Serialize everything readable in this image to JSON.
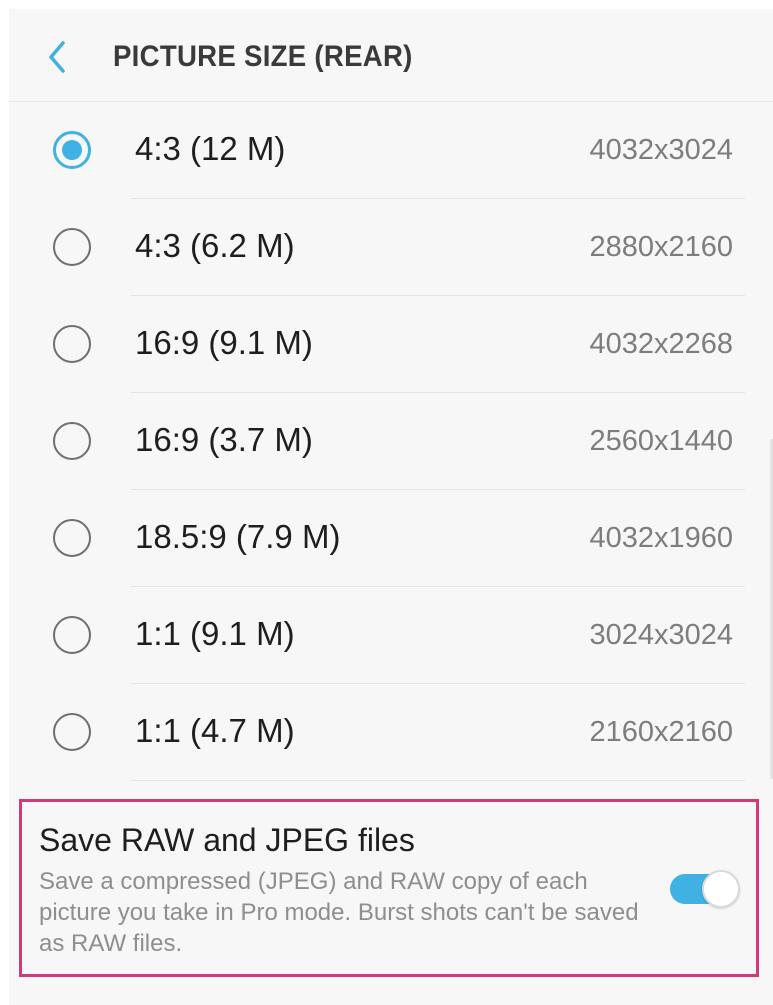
{
  "header": {
    "title": "PICTURE SIZE (REAR)",
    "back_icon": "chevron-left-icon"
  },
  "accent_color": "#3fb1e3",
  "highlight_border_color": "#d2397a",
  "sizes": [
    {
      "label": "4:3 (12 M)",
      "resolution": "4032x3024",
      "selected": true
    },
    {
      "label": "4:3 (6.2 M)",
      "resolution": "2880x2160",
      "selected": false
    },
    {
      "label": "16:9 (9.1 M)",
      "resolution": "4032x2268",
      "selected": false
    },
    {
      "label": "16:9 (3.7 M)",
      "resolution": "2560x1440",
      "selected": false
    },
    {
      "label": "18.5:9 (7.9 M)",
      "resolution": "4032x1960",
      "selected": false
    },
    {
      "label": "1:1 (9.1 M)",
      "resolution": "3024x3024",
      "selected": false
    },
    {
      "label": "1:1 (4.7 M)",
      "resolution": "2160x2160",
      "selected": false
    }
  ],
  "raw_option": {
    "title": "Save RAW and JPEG files",
    "description": "Save a compressed (JPEG) and RAW copy of each picture you take in Pro mode. Burst shots can't be saved as RAW files.",
    "enabled": true
  }
}
